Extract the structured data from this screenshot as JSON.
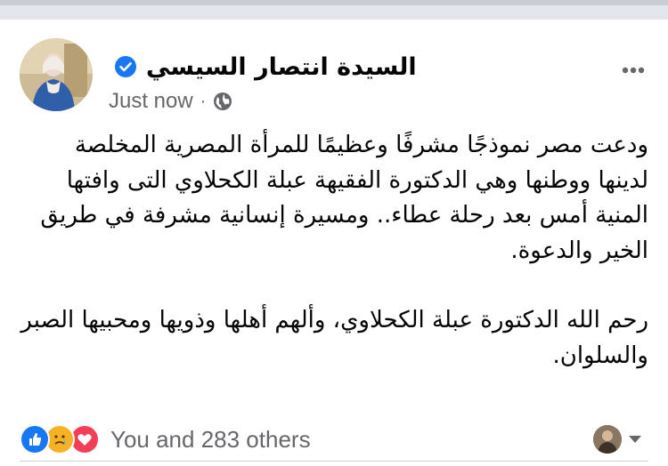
{
  "post": {
    "author": {
      "name": "السيدة انتصار السيسي",
      "verified": true,
      "avatar_icon": "profile-photo"
    },
    "meta": {
      "time": "Just now",
      "separator": "·",
      "audience_icon": "globe-icon"
    },
    "paragraphs": [
      "ودعت مصر نموذجًا مشرفًا وعظيمًا للمرأة المصرية المخلصة لدينها ووطنها وهي الدكتورة الفقيهة عبلة الكحلاوي التى وافتها المنية أمس بعد رحلة عطاء.. ومسيرة إنسانية مشرفة في طريق الخير والدعوة.",
      "رحم الله الدكتورة عبلة الكحلاوي، وألهم أهلها وذويها ومحبيها الصبر والسلوان."
    ],
    "reactions": {
      "icons": [
        "like-icon",
        "care-icon",
        "love-icon"
      ],
      "count_text": "You and 283 others"
    }
  },
  "colors": {
    "verified": "#1877f2",
    "like": "#1877f2",
    "love": "#f33e58",
    "care": "#f7b125",
    "secondary_text": "#65676b"
  }
}
